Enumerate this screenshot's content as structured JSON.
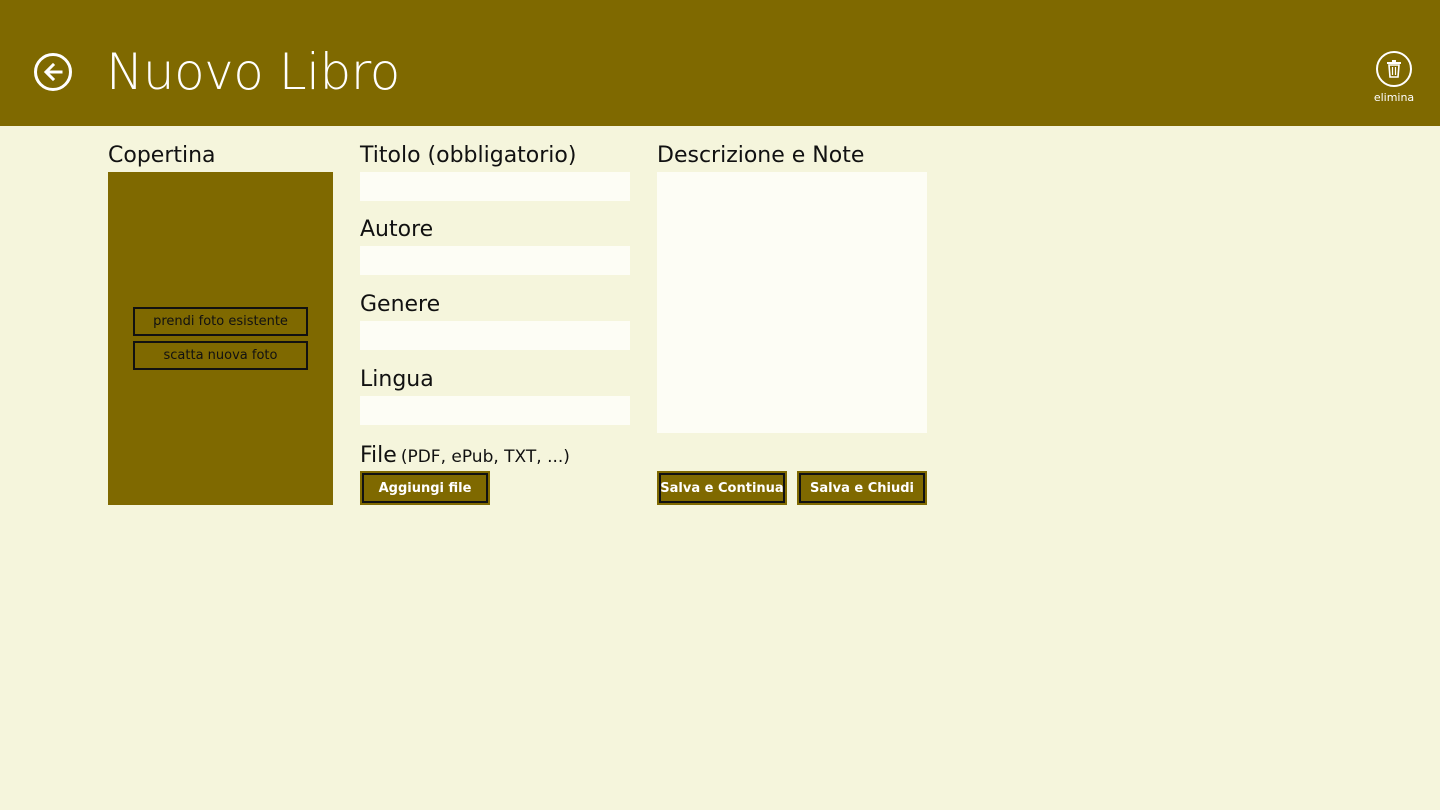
{
  "header": {
    "title": "Nuovo Libro",
    "back_icon": "arrow-left-icon",
    "delete_icon": "trash-icon",
    "delete_label": "elimina",
    "color": "#7f6900"
  },
  "cover": {
    "label": "Copertina",
    "pick_existing_label": "prendi foto esistente",
    "take_new_label": "scatta nuova foto"
  },
  "form": {
    "title_label": "Titolo (obbligatorio)",
    "title_value": "",
    "author_label": "Autore",
    "author_value": "",
    "genre_label": "Genere",
    "genre_value": "",
    "language_label": "Lingua",
    "language_value": "",
    "file_label": "File",
    "file_hint": "(PDF, ePub, TXT, ...)",
    "add_file_label": "Aggiungi file"
  },
  "notes": {
    "label": "Descrizione e Note",
    "value": ""
  },
  "actions": {
    "save_continue_label": "Salva e Continua",
    "save_close_label": "Salva e Chiudi"
  }
}
